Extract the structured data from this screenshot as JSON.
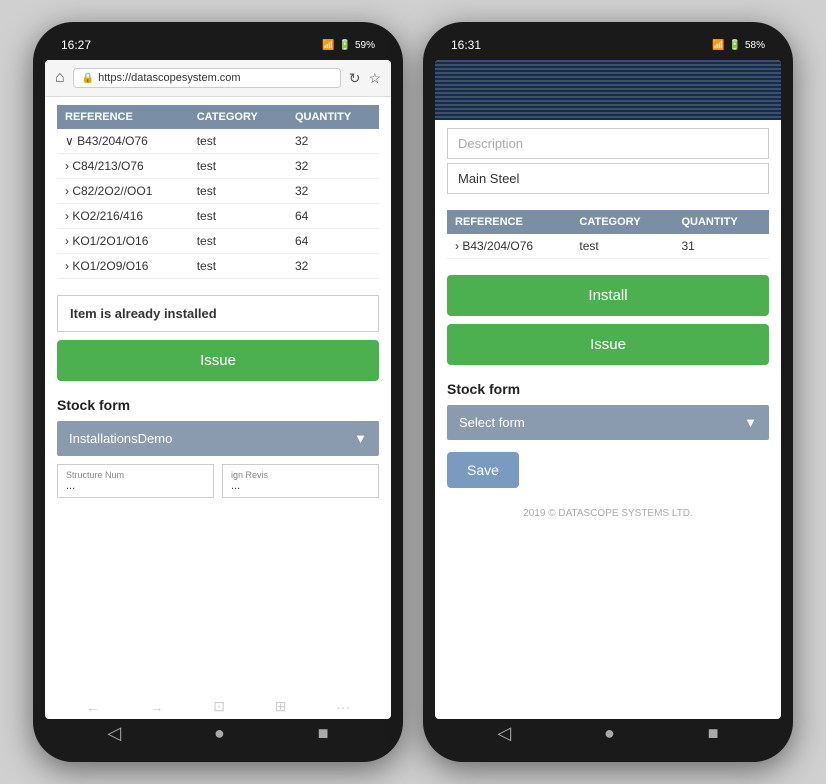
{
  "phone1": {
    "status_bar": {
      "time": "16:27",
      "battery": "59%"
    },
    "browser": {
      "url": "https://datascopesystem.com",
      "home_icon": "⌂",
      "reload_icon": "↻",
      "star_icon": "☆"
    },
    "table": {
      "headers": [
        "REFERENCE",
        "CATEGORY",
        "QUANTITY"
      ],
      "rows": [
        {
          "ref": "B43/204/O76",
          "cat": "test",
          "qty": "32",
          "expanded": true
        },
        {
          "ref": "C84/213/O76",
          "cat": "test",
          "qty": "32",
          "expanded": false
        },
        {
          "ref": "C82/2O2//OO1",
          "cat": "test",
          "qty": "32",
          "expanded": false
        },
        {
          "ref": "KO2/216/416",
          "cat": "test",
          "qty": "64",
          "expanded": false
        },
        {
          "ref": "KO1/2O1/O16",
          "cat": "test",
          "qty": "64",
          "expanded": false
        },
        {
          "ref": "KO1/2O9/O16",
          "cat": "test",
          "qty": "32",
          "expanded": false
        }
      ]
    },
    "alert": {
      "message": "Item is already installed"
    },
    "issue_button": "Issue",
    "stock_form": {
      "title": "Stock form",
      "selected": "InstallationsDemo",
      "dropdown_arrow": "▼"
    },
    "structure": {
      "num_label": "Structure Num",
      "num_value": "...",
      "rev_label": "ign Revis",
      "rev_value": "..."
    },
    "nav_buttons": [
      "←",
      "→",
      "⊡",
      "⊞",
      "···"
    ]
  },
  "phone2": {
    "status_bar": {
      "time": "16:31",
      "battery": "58%"
    },
    "description": {
      "placeholder": "Description",
      "value": "Main Steel"
    },
    "table": {
      "headers": [
        "REFERENCE",
        "CATEGORY",
        "QUANTITY"
      ],
      "rows": [
        {
          "ref": "B43/204/O76",
          "cat": "test",
          "qty": "31",
          "expanded": false
        }
      ]
    },
    "install_button": "Install",
    "issue_button": "Issue",
    "stock_form": {
      "title": "Stock form",
      "placeholder": "Select form",
      "dropdown_arrow": "▼"
    },
    "save_button": "Save",
    "footer": "2019 © DATASCOPE SYSTEMS LTD."
  }
}
